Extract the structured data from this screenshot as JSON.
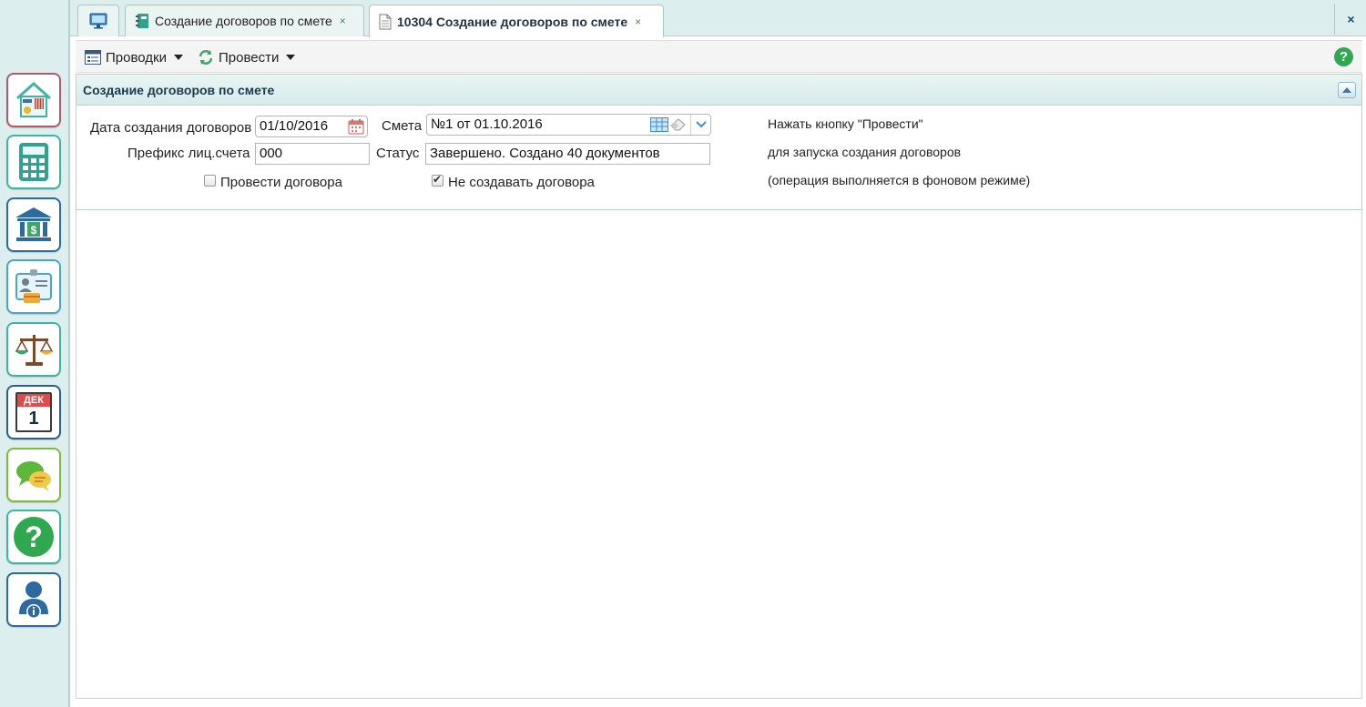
{
  "sidebar": {
    "items": [
      {
        "name": "utilities-icon"
      },
      {
        "name": "calculator-icon"
      },
      {
        "name": "bank-icon"
      },
      {
        "name": "id-card-icon"
      },
      {
        "name": "scales-icon"
      },
      {
        "name": "calendar-icon",
        "month": "ДЕК",
        "day": "1"
      },
      {
        "name": "chat-icon"
      },
      {
        "name": "help-icon",
        "glyph": "?"
      },
      {
        "name": "user-info-icon"
      }
    ]
  },
  "tabs": [
    {
      "label": "",
      "icon": "monitor-icon"
    },
    {
      "label": "Создание договоров по смете",
      "icon": "notebook-icon",
      "close": "×"
    },
    {
      "label": "10304 Создание договоров по смете",
      "icon": "document-icon",
      "close": "×",
      "active": true
    }
  ],
  "global_close": "×",
  "toolbar": {
    "postings_label": "Проводки",
    "post_label": "Провести",
    "help_glyph": "?"
  },
  "panel": {
    "title": "Создание договоров по смете",
    "date_label": "Дата создания договоров",
    "date_value": "01/10/2016",
    "estimate_label": "Смета",
    "estimate_value": "№1 от 01.10.2016",
    "prefix_label": "Префикс лиц.счета",
    "prefix_value": "000",
    "status_label": "Статус",
    "status_value": "Завершено. Создано 40 документов",
    "post_contracts_label": "Провести договора",
    "post_contracts_checked": false,
    "no_create_label": "Не создавать договора",
    "no_create_checked": true,
    "info_line1": "Нажать кнопку \"Провести\"",
    "info_line2": "для запуска создания договоров",
    "info_line3": "(операция выполняется в фоновом режиме)"
  },
  "colors": {
    "sidebar_bg": "#dcefee",
    "accent": "#3fb4a5",
    "help_green": "#2fa84f"
  }
}
